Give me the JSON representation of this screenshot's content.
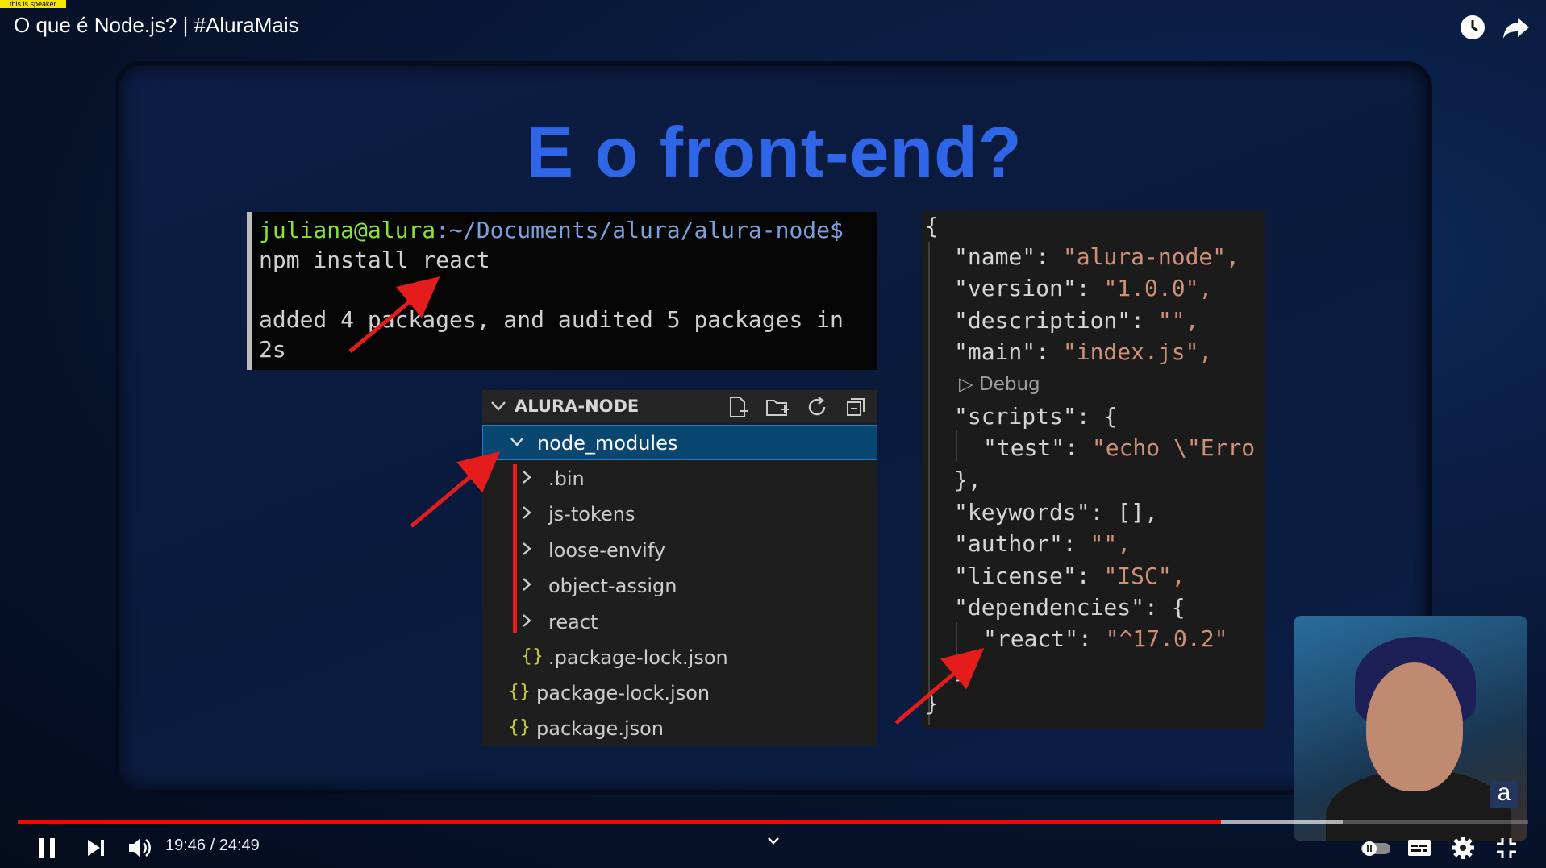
{
  "overlay_tag": "this is speaker",
  "video": {
    "title": "O que é Node.js? | #AluraMais",
    "current_time": "19:46",
    "duration": "24:49",
    "time_display": "19:46 / 24:49",
    "progress_fraction": 0.796
  },
  "top_icons": [
    "watch-later-icon",
    "share-icon"
  ],
  "slide": {
    "title": "E o front-end?",
    "terminal": {
      "user": "juliana@alura",
      "path": ":~/Documents/alura/alura-node$",
      "command": "npm install react",
      "output_line1": "added 4 packages, and audited 5 packages in",
      "output_line2": "2s"
    },
    "explorer": {
      "root": "ALURA-NODE",
      "items": [
        {
          "label": "node_modules",
          "kind": "folder-open"
        },
        {
          "label": ".bin",
          "kind": "folder"
        },
        {
          "label": "js-tokens",
          "kind": "folder"
        },
        {
          "label": "loose-envify",
          "kind": "folder"
        },
        {
          "label": "object-assign",
          "kind": "folder"
        },
        {
          "label": "react",
          "kind": "folder"
        },
        {
          "label": ".package-lock.json",
          "kind": "json"
        },
        {
          "label": "package-lock.json",
          "kind": "json"
        },
        {
          "label": "package.json",
          "kind": "json"
        }
      ]
    },
    "package_json": {
      "open_brace": "{",
      "name_key": "\"name\": ",
      "name_val": "\"alura-node\",",
      "version_key": "\"version\": ",
      "version_val": "\"1.0.0\",",
      "description_key": "\"description\": ",
      "description_val": "\"\",",
      "main_key": "\"main\": ",
      "main_val": "\"index.js\",",
      "debug": "Debug",
      "scripts_line": "\"scripts\": {",
      "test_key": "\"test\": ",
      "test_val": "\"echo \\\"Erro",
      "scripts_close": "},",
      "keywords_line": "\"keywords\": [],",
      "author_key": "\"author\": ",
      "author_val": "\"\",",
      "license_key": "\"license\": ",
      "license_val": "\"ISC\",",
      "deps_line": "\"dependencies\": {",
      "react_key": "\"react\": ",
      "react_val": "\"^17.0.2\"",
      "deps_close": "}",
      "close_brace": "}"
    }
  },
  "controls": [
    "pause-icon",
    "next-icon",
    "volume-icon",
    "chevron-down-icon",
    "autoplay-toggle",
    "subtitles-icon",
    "settings-icon",
    "exit-fullscreen-icon"
  ],
  "colors": {
    "progress": "#ff0000",
    "title_blue": "#2f66e8",
    "arrow_red": "#e51c1c"
  }
}
